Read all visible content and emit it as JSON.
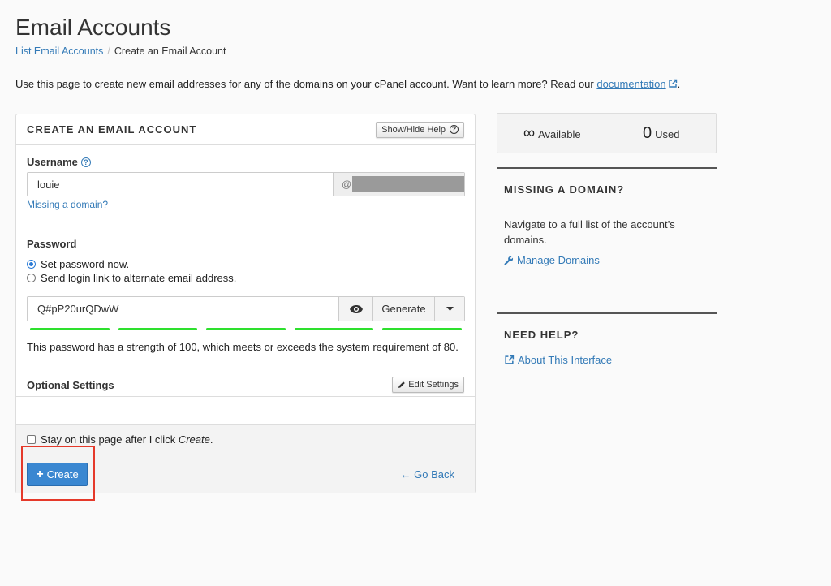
{
  "page": {
    "title": "Email Accounts",
    "breadcrumb": {
      "parent": "List Email Accounts",
      "current": "Create an Email Account"
    },
    "intro": "Use this page to create new email addresses for any of the domains on your cPanel account. Want to learn more? Read our ",
    "intro_link": "documentation",
    "intro_end": "."
  },
  "panel": {
    "title": "CREATE AN EMAIL ACCOUNT",
    "help_toggle": "Show/Hide Help",
    "username_label": "Username",
    "username_value": "louie",
    "at_sign": "@",
    "missing_domain": "Missing a domain?",
    "password_label": "Password",
    "radio_set_now": "Set password now.",
    "radio_send_link": "Send login link to alternate email address.",
    "password_value": "Q#pP20urQDwW",
    "generate_label": "Generate",
    "strength_text": "This password has a strength of 100, which meets or exceeds the system requirement of 80.",
    "strength_level": 100,
    "optional_settings": "Optional Settings",
    "edit_settings": "Edit Settings",
    "stay_text": "Stay on this page after I click ",
    "stay_em": "Create",
    "stay_end": ".",
    "create_label": "Create",
    "go_back_label": "Go Back"
  },
  "sidebar": {
    "available_value": "∞",
    "available_label": "Available",
    "used_value": "0",
    "used_label": "Used",
    "missing_domain_heading": "MISSING A DOMAIN?",
    "missing_domain_text": "Navigate to a full list of the account’s domains.",
    "manage_domains": "Manage Domains",
    "need_help_heading": "NEED HELP?",
    "about_interface": "About This Interface"
  },
  "colors": {
    "accent": "#337ab7",
    "primary_button": "#3a87d1",
    "strength": "#2ee02e",
    "highlight": "#e5392a"
  }
}
